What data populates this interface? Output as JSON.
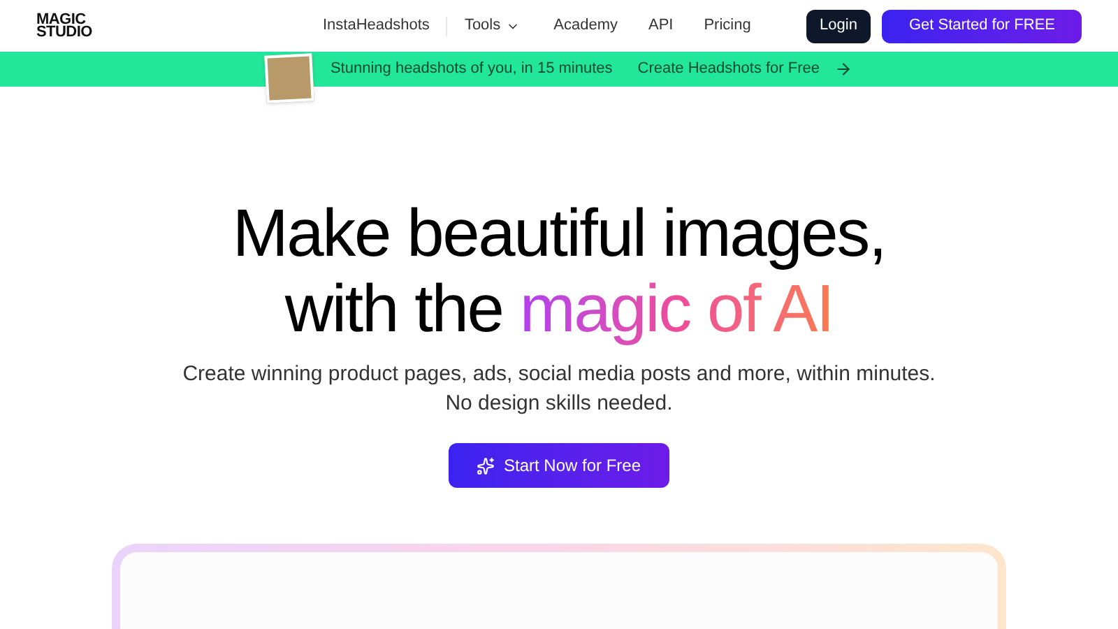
{
  "logo": {
    "line_1": "MAGIC",
    "line_2": "STUDIO"
  },
  "nav": [
    {
      "label": "InstaHeadshots",
      "kind": "link"
    },
    {
      "label": "Tools",
      "kind": "dropdown"
    },
    {
      "label": "Academy",
      "kind": "link"
    },
    {
      "label": "API",
      "kind": "link"
    },
    {
      "label": "Pricing",
      "kind": "link"
    }
  ],
  "auth": {
    "login": "Login",
    "get_started": "Get Started for FREE"
  },
  "banner": {
    "text": "Stunning headshots of you, in 15 minutes",
    "link": "Create Headshots for Free"
  },
  "hero": {
    "headline_line_1": "Make beautiful images,",
    "headline_line_2": "with the",
    "headline_highlight": "magic of AI",
    "subtitle_line_1": "Create winning product pages, ads, social media posts and more, within minutes.",
    "subtitle_line_2": "No design skills needed.",
    "cta": "Start Now for Free"
  }
}
